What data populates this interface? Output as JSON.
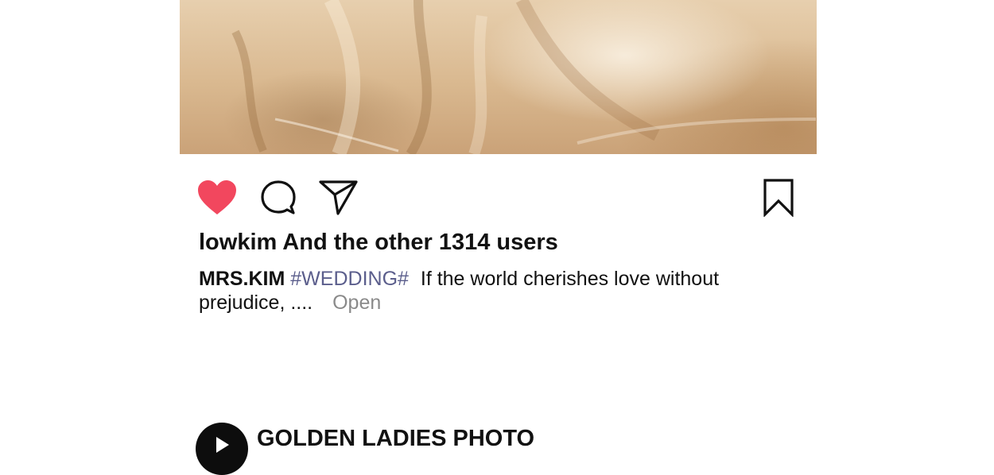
{
  "post": {
    "likes_text": "lowkim And the other 1314 users",
    "caption_user": "MRS.KIM",
    "caption_hashtag": "#WEDDING#",
    "caption_text": "If the world cherishes love without prejudice, ....",
    "open_label": "Open"
  },
  "actions": {
    "like_color": "#f2475e",
    "icons": [
      "heart-icon",
      "comment-icon",
      "send-icon",
      "bookmark-icon"
    ]
  },
  "next_post": {
    "account_name": "GOLDEN LADIES PHOTO"
  }
}
